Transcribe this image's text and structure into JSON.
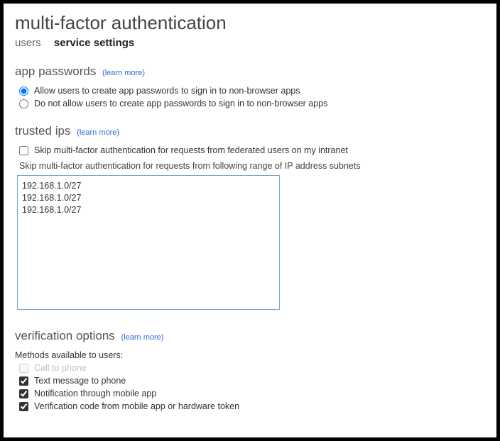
{
  "title": "multi-factor authentication",
  "tabs": {
    "users": "users",
    "service_settings": "service settings"
  },
  "learn_more": "(learn more)",
  "sections": {
    "app_passwords": {
      "heading": "app passwords",
      "allow_label": "Allow users to create app passwords to sign in to non-browser apps",
      "deny_label": "Do not allow users to create app passwords to sign in to non-browser apps"
    },
    "trusted_ips": {
      "heading": "trusted ips",
      "skip_federated_label": "Skip multi-factor authentication for requests from federated users on my intranet",
      "skip_range_label": "Skip multi-factor authentication for requests from following range of IP address subnets",
      "ip_value": "192.168.1.0/27\n192.168.1.0/27\n192.168.1.0/27"
    },
    "verification": {
      "heading": "verification options",
      "methods_label": "Methods available to users:",
      "options": {
        "call": "Call to phone",
        "text": "Text message to phone",
        "notif": "Notification through mobile app",
        "code": "Verification code from mobile app or hardware token"
      }
    }
  }
}
